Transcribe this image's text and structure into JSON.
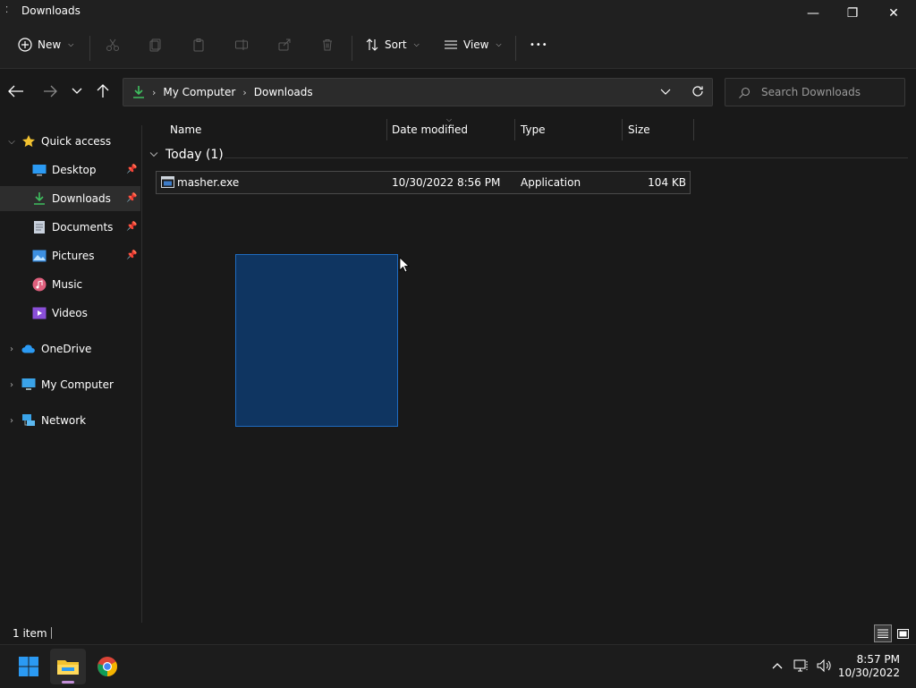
{
  "window": {
    "title": "Downloads",
    "minimize_glyph": "—",
    "maximize_glyph": "❐",
    "close_glyph": "✕"
  },
  "commandbar": {
    "new_label": "New",
    "sort_label": "Sort",
    "view_label": "View",
    "more_glyph": "•••"
  },
  "address": {
    "crumbs": [
      "My Computer",
      "Downloads"
    ],
    "search_placeholder": "Search Downloads"
  },
  "navpane": {
    "quick_access": "Quick access",
    "items": [
      {
        "label": "Desktop",
        "icon": "desktop-icon",
        "pinned": true
      },
      {
        "label": "Downloads",
        "icon": "download-icon",
        "pinned": true,
        "selected": true
      },
      {
        "label": "Documents",
        "icon": "document-icon",
        "pinned": true
      },
      {
        "label": "Pictures",
        "icon": "pictures-icon",
        "pinned": true
      },
      {
        "label": "Music",
        "icon": "music-icon",
        "pinned": false
      },
      {
        "label": "Videos",
        "icon": "video-icon",
        "pinned": false
      }
    ],
    "roots": [
      {
        "label": "OneDrive",
        "icon": "cloud-icon"
      },
      {
        "label": "My Computer",
        "icon": "computer-icon"
      },
      {
        "label": "Network",
        "icon": "network-icon"
      }
    ]
  },
  "columns": {
    "name": "Name",
    "date": "Date modified",
    "type": "Type",
    "size": "Size"
  },
  "group": {
    "label": "Today (1)"
  },
  "files": [
    {
      "name": "masher.exe",
      "date": "10/30/2022 8:56 PM",
      "type": "Application",
      "size": "104 KB"
    }
  ],
  "status": {
    "count": "1 item"
  },
  "taskbar": {
    "time": "8:57 PM",
    "date": "10/30/2022"
  },
  "colors": {
    "accent": "#0f3561",
    "download_green": "#3fbf5f",
    "folder_yellow": "#f2c230",
    "windows_blue": "#2b9af3"
  }
}
